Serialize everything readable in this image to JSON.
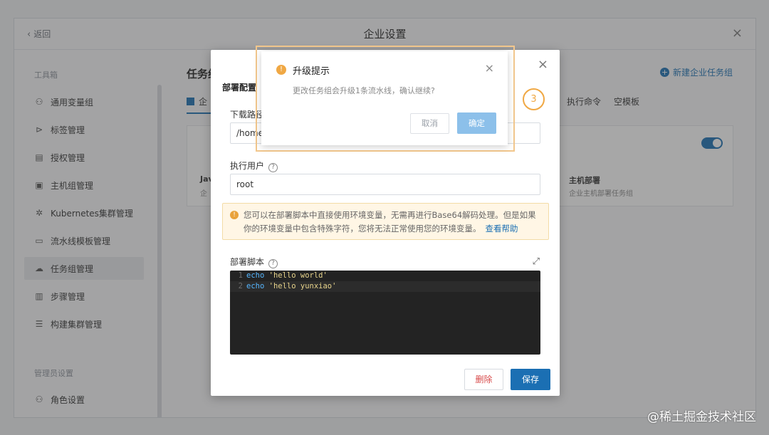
{
  "header": {
    "back_label": "返回",
    "title": "企业设置"
  },
  "sidebar": {
    "group1": "工具箱",
    "items": [
      {
        "label": "通用变量组",
        "icon": "variable-icon"
      },
      {
        "label": "标签管理",
        "icon": "tag-icon"
      },
      {
        "label": "授权管理",
        "icon": "authorization-icon"
      },
      {
        "label": "主机组管理",
        "icon": "host-group-icon"
      },
      {
        "label": "Kubernetes集群管理",
        "icon": "kubernetes-icon"
      },
      {
        "label": "流水线模板管理",
        "icon": "pipeline-template-icon"
      },
      {
        "label": "任务组管理",
        "icon": "task-group-icon",
        "active": true
      },
      {
        "label": "步骤管理",
        "icon": "step-icon"
      },
      {
        "label": "构建集群管理",
        "icon": "build-cluster-icon"
      }
    ],
    "group2": "管理员设置",
    "admin_items": [
      {
        "label": "角色设置",
        "icon": "role-icon"
      }
    ]
  },
  "main": {
    "title": "任务组",
    "new_button": "新建企业任务组",
    "tab_first": "企",
    "tab_exec": "执行命令",
    "tab_empty": "空模板",
    "card_left_title": "Jav",
    "card_left_desc": "企",
    "card_right_title": "主机部署",
    "card_right_desc": "企业主机部署任务组"
  },
  "modal": {
    "heading": "部署配置",
    "download_path_label": "下载路径",
    "download_path_value": "/home/",
    "exec_user_label": "执行用户",
    "exec_user_value": "root",
    "notice_text": "您可以在部署脚本中直接使用环境变量，无需再进行Base64解码处理。但是如果你的环境变量中包含特殊字符，您将无法正常使用您的环境变量。",
    "notice_link": "查看帮助",
    "script_label": "部署脚本",
    "script_lines": [
      {
        "num": "1",
        "cmd": "echo",
        "arg": "'hello world'"
      },
      {
        "num": "2",
        "cmd": "echo",
        "arg": "'hello yunxiao'"
      }
    ],
    "delete_button": "删除",
    "save_button": "保存"
  },
  "step_marker": "3",
  "dialog": {
    "title": "升级提示",
    "message": "更改任务组会升级1条流水线，确认继续?",
    "cancel": "取消",
    "confirm": "确定"
  },
  "watermark": "@稀土掘金技术社区",
  "colors": {
    "primary": "#1b6fb3",
    "warning": "#f0a844",
    "danger": "#d84b4b"
  }
}
